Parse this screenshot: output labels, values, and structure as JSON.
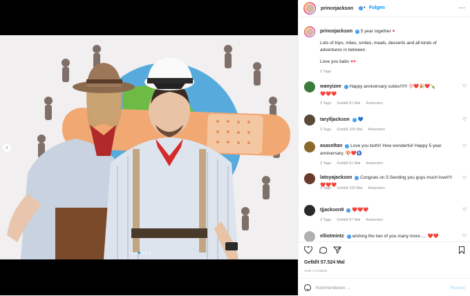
{
  "header": {
    "username": "princejackson",
    "separator": "•",
    "follow_label": "Folgen",
    "more_label": "···"
  },
  "caption": {
    "username": "princejackson",
    "title_text": "5 year together",
    "line1": "Lots of trips, miles, smiles, meals, desserts and all kinds of adventures in between.",
    "line2": "Love you babs",
    "time": "3 Tage"
  },
  "comments": [
    {
      "username": "wanyizee",
      "text": "Happy anniversary cuties!!!!!!",
      "emoji": "😍❤️🎉❤️🍾",
      "emoji2": "❤️❤️❤️",
      "time": "3 Tage",
      "likes": "Gefällt 51 Mal",
      "reply": "Antworten",
      "avatar_color": "#3a7a3a"
    },
    {
      "username": "tarylljackson",
      "text": "",
      "emoji": "💙",
      "time": "3 Tage",
      "likes": "Gefällt 106 Mal",
      "reply": "Antworten",
      "avatar_color": "#5a4a3a"
    },
    {
      "username": "asasoltan",
      "text": "Love you both!! How wonderful! Happy 5 year anniversary.",
      "emoji": "🍄❤️🧿",
      "time": "3 Tage",
      "likes": "Gefällt 51 Mal",
      "reply": "Antworten",
      "avatar_color": "#8a6a2a"
    },
    {
      "username": "latoyajackson",
      "text": "Congrats on 5 Sending you guys much love!!!!",
      "emoji": "❤️❤️❤️",
      "time": "3 Tage",
      "likes": "Gefällt 143 Mal",
      "reply": "Antworten",
      "avatar_color": "#6a3a2a"
    },
    {
      "username": "tjjackson9",
      "text": "",
      "emoji": "❤️❤️❤️",
      "time": "3 Tage",
      "likes": "Gefällt 97 Mal",
      "reply": "Antworten",
      "avatar_color": "#2a2a2a"
    },
    {
      "username": "elliotmintz",
      "text": "wishing the two of you many more.....",
      "emoji": "❤️❤️",
      "time": "",
      "likes": "",
      "reply": "",
      "avatar_color": "#b0b0b0"
    }
  ],
  "actions": {
    "likes": "Gefällt 57.524 Mal",
    "date": "VOR 3 TAGEN"
  },
  "add_comment": {
    "placeholder": "Kommentieren ...",
    "post_label": "Posten"
  },
  "colors": {
    "accent": "#0095f6",
    "heart": "#ed4956",
    "verified": "#3897f0"
  },
  "media": {
    "carousel_prev": "‹",
    "carousel_count": 6,
    "carousel_active": 2
  }
}
